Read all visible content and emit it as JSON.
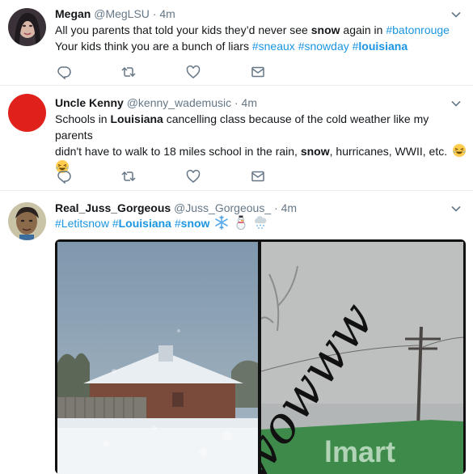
{
  "tweets": [
    {
      "name": "Megan",
      "handle": "@MegLSU",
      "time": "4m",
      "text_1": "All you parents that told your kids they’d never see ",
      "text_2": "snow",
      "text_3": " again in ",
      "tag_1": "#batonrouge",
      "text_4": "Your kids think you are a bunch of liars ",
      "tag_2": "#sneaux",
      "tag_3": "#snowday",
      "tag_4_prefix": "#",
      "tag_4_word": "louisiana"
    },
    {
      "name": "Uncle Kenny",
      "handle": "@kenny_wademusic",
      "time": "4m",
      "text_1": "Schools in ",
      "text_2": "Louisiana",
      "text_3": " cancelling class because of the cold weather like my parents",
      "text_4": "didn't have to walk to 18 miles school in the rain, ",
      "text_5": "snow",
      "text_6": ", hurricanes, WWII, etc."
    },
    {
      "name": "Real_Juss_Gorgeous",
      "handle": "@Juss_Gorgeous_",
      "time": "4m",
      "tag_1": "#Letitsnow",
      "tag_2_prefix": "#",
      "tag_2_word": "Louisiana",
      "tag_3_prefix": "#",
      "tag_3_word": "snow",
      "image_text": "wowww",
      "sign_text": "lmart"
    }
  ],
  "colors": {
    "link": "#1b95e0",
    "meta": "#657786",
    "divider": "#e6ecf0",
    "kenny_avatar": "#e0201b"
  },
  "icons": [
    "reply-icon",
    "retweet-icon",
    "like-icon",
    "message-icon",
    "chevron-down-icon",
    "laughing-emoji-icon",
    "snowflake-icon",
    "snowman-icon",
    "snow-cloud-icon"
  ]
}
